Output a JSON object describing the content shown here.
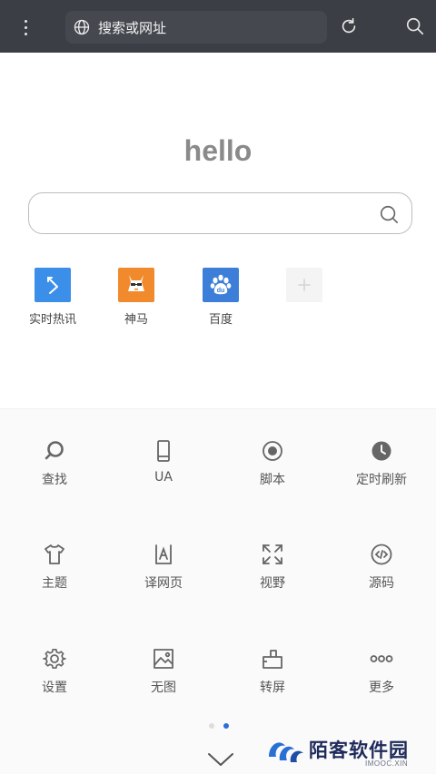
{
  "toolbar": {
    "address_placeholder": "搜索或网址"
  },
  "home": {
    "title": "hello",
    "shortcuts": [
      {
        "label": "实时热讯",
        "color": "#3b8fe8"
      },
      {
        "label": "神马",
        "color": "#f08a2c"
      },
      {
        "label": "百度",
        "color": "#3d7fd8"
      },
      {
        "label": "",
        "color": "#f2f2f2"
      }
    ]
  },
  "menu": {
    "items": [
      {
        "label": "查找",
        "icon": "search-icon"
      },
      {
        "label": "UA",
        "icon": "phone-icon"
      },
      {
        "label": "脚本",
        "icon": "record-icon"
      },
      {
        "label": "定时刷新",
        "icon": "clock-icon"
      },
      {
        "label": "主题",
        "icon": "tshirt-icon"
      },
      {
        "label": "译网页",
        "icon": "translate-icon"
      },
      {
        "label": "视野",
        "icon": "expand-icon"
      },
      {
        "label": "源码",
        "icon": "code-icon"
      },
      {
        "label": "设置",
        "icon": "gear-icon"
      },
      {
        "label": "无图",
        "icon": "image-icon"
      },
      {
        "label": "转屏",
        "icon": "rotate-screen-icon"
      },
      {
        "label": "更多",
        "icon": "more-icon"
      }
    ]
  },
  "pager": {
    "page_count": 2,
    "current_page": 2
  },
  "watermark": {
    "name": "陌客软件园",
    "sub": "IMOOC.XIN"
  },
  "colors": {
    "toolbar_bg": "#3b3e44",
    "accent": "#2a6fd4",
    "icon_gray": "#666666"
  }
}
